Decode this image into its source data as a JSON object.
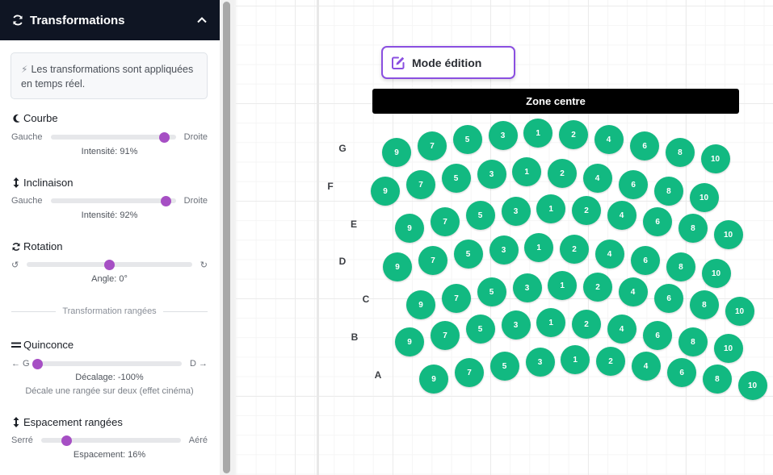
{
  "panel": {
    "title": "Transformations",
    "info": "Les transformations sont appliquées en temps réel.",
    "courbe": {
      "title": "Courbe",
      "left": "Gauche",
      "right": "Droite",
      "value": 91,
      "caption": "Intensité: 91%"
    },
    "inclinaison": {
      "title": "Inclinaison",
      "left": "Gauche",
      "right": "Droite",
      "value": 92,
      "caption": "Intensité: 92%"
    },
    "rotation": {
      "title": "Rotation",
      "left": "↺",
      "right": "↻",
      "value": 0,
      "caption": "Angle: 0°"
    },
    "divider": "Transformation rangées",
    "quinconce": {
      "title": "Quinconce",
      "left": "← G",
      "right": "D →",
      "value": -100,
      "caption": "Décalage: -100%",
      "note": "Décale une rangée sur deux (effet cinéma)"
    },
    "espacement": {
      "title": "Espacement rangées",
      "left": "Serré",
      "right": "Aéré",
      "value": 16,
      "caption": "Espacement: 16%"
    }
  },
  "canvas": {
    "mode_label": "Mode édition",
    "zone_label": "Zone centre",
    "seat_color": "#12b981",
    "seat_numbers": [
      "9",
      "7",
      "5",
      "3",
      "1",
      "2",
      "4",
      "6",
      "8",
      "10"
    ],
    "rows": [
      {
        "label": "G",
        "seats": [
          "9",
          "7",
          "5",
          "3",
          "1",
          "2",
          "4",
          "6",
          "8",
          "10"
        ]
      },
      {
        "label": "F",
        "seats": [
          "9",
          "7",
          "5",
          "3",
          "1",
          "2",
          "4",
          "6",
          "8",
          "10"
        ]
      },
      {
        "label": "E",
        "seats": [
          "9",
          "7",
          "5",
          "3",
          "1",
          "2",
          "4",
          "6",
          "8",
          "10"
        ]
      },
      {
        "label": "D",
        "seats": [
          "9",
          "7",
          "5",
          "3",
          "1",
          "2",
          "4",
          "6",
          "8",
          "10"
        ]
      },
      {
        "label": "C",
        "seats": [
          "9",
          "7",
          "5",
          "3",
          "1",
          "2",
          "4",
          "6",
          "8",
          "10"
        ]
      },
      {
        "label": "B",
        "seats": [
          "9",
          "7",
          "5",
          "3",
          "1",
          "2",
          "4",
          "6",
          "8",
          "10"
        ]
      },
      {
        "label": "A",
        "seats": [
          "9",
          "7",
          "5",
          "3",
          "1",
          "2",
          "4",
          "6",
          "8",
          "10"
        ]
      }
    ]
  },
  "colors": {
    "accent": "#a64fc4",
    "header_bg": "#0f1523",
    "mode_border": "#8a4fe0"
  }
}
